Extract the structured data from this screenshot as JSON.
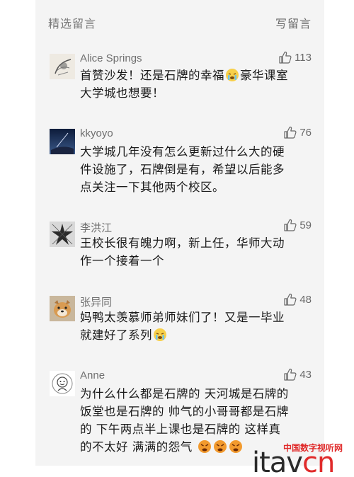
{
  "header": {
    "title": "精选留言",
    "write_label": "写留言"
  },
  "comments": [
    {
      "user": "Alice Springs",
      "likes": "113",
      "avatar_icon": "avatar-sketch",
      "lines": [
        "首赞沙发！还是石牌的幸福",
        "豪华课室",
        "大学城也想要！"
      ]
    },
    {
      "user": "kkyoyo",
      "likes": "76",
      "avatar_icon": "avatar-night-sky",
      "lines": [
        "大学城几年没有怎么更新过什么大的硬",
        "件设施了，石牌倒是有，希望以后能多",
        "点关注一下其他两个校区。"
      ]
    },
    {
      "user": "李洪江",
      "likes": "59",
      "avatar_icon": "avatar-star-sketch",
      "lines": [
        "王校长很有魄力啊，新上任，华师大动",
        "作一个接着一个"
      ]
    },
    {
      "user": "张异同",
      "likes": "48",
      "avatar_icon": "avatar-dog",
      "lines": [
        "妈鸭太羡慕师弟师妹们了！又是一毕业",
        "就建好了系列"
      ]
    },
    {
      "user": "Anne",
      "likes": "43",
      "avatar_icon": "avatar-cartoon",
      "lines": [
        "为什么什么都是石牌的 天河城是石牌的",
        "饭堂也是石牌的 帅气的小哥哥都是石牌",
        "的 下午两点半上课也是石牌的 这样真",
        "的不太好 满满的怨气"
      ]
    }
  ],
  "colors": {
    "panel_bg": "#f4f4f4",
    "text": "#1a1a1a",
    "meta": "#6f6f6f",
    "watermark_red": "#e02a2a"
  },
  "watermark": {
    "cn": "中国数字视听网",
    "logo_a": "itav",
    "logo_b": "cn",
    "logo_dot": ".com"
  }
}
